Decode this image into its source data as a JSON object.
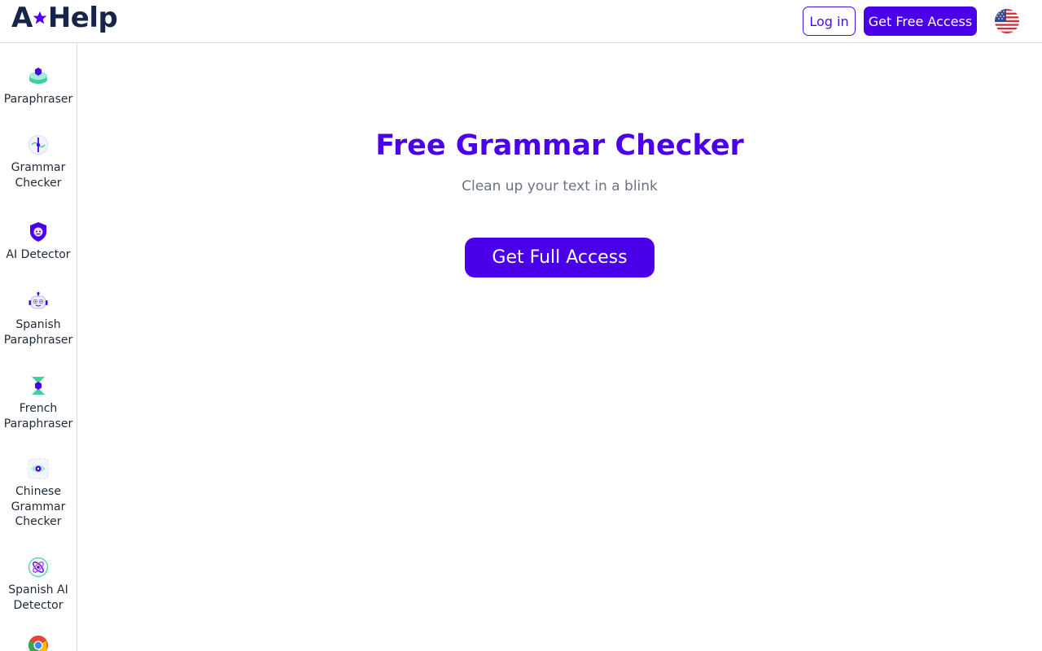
{
  "header": {
    "logo_left": "A",
    "logo_right": "Help",
    "login_label": "Log in",
    "free_access_label": "Get Free Access",
    "language_icon": "us-flag-icon"
  },
  "sidebar": {
    "items": [
      {
        "label": "Paraphraser",
        "icon": "paraphraser-icon"
      },
      {
        "label": "Grammar\nChecker",
        "icon": "grammar-checker-icon"
      },
      {
        "label": "AI Detector",
        "icon": "ai-detector-icon"
      },
      {
        "label": "Spanish\nParaphraser",
        "icon": "robot-icon"
      },
      {
        "label": "French\nParaphraser",
        "icon": "hourglass-icon"
      },
      {
        "label": "Chinese\nGrammar\nChecker",
        "icon": "eye-scan-icon"
      },
      {
        "label": "Spanish AI\nDetector",
        "icon": "atom-icon"
      },
      {
        "label": "",
        "icon": "chrome-icon"
      }
    ]
  },
  "main": {
    "title": "Free Grammar Checker",
    "subtitle": "Clean up your text in a blink",
    "cta_label": "Get Full Access"
  },
  "colors": {
    "brand": "#4a00e8",
    "logo": "#16244a",
    "accent_green": "#3ecf9a"
  }
}
